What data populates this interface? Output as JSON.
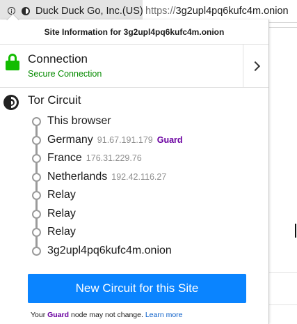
{
  "urlbar": {
    "org": "Duck Duck Go, Inc.(US)",
    "url_scheme": "https://",
    "url_host": "3g2upl4pq6kufc4m.onion"
  },
  "panel": {
    "header": "Site Information for 3g2upl4pq6kufc4m.onion",
    "connection": {
      "title": "Connection",
      "status": "Secure Connection"
    },
    "circuit": {
      "title": "Tor Circuit",
      "nodes": [
        {
          "name": "This browser",
          "ip": "",
          "badge": ""
        },
        {
          "name": "Germany",
          "ip": "91.67.191.179",
          "badge": "Guard"
        },
        {
          "name": "France",
          "ip": "176.31.229.76",
          "badge": ""
        },
        {
          "name": "Netherlands",
          "ip": "192.42.116.27",
          "badge": ""
        },
        {
          "name": "Relay",
          "ip": "",
          "badge": ""
        },
        {
          "name": "Relay",
          "ip": "",
          "badge": ""
        },
        {
          "name": "Relay",
          "ip": "",
          "badge": ""
        },
        {
          "name": "3g2upl4pq6kufc4m.onion",
          "ip": "",
          "badge": ""
        }
      ]
    },
    "new_circuit_label": "New Circuit for this Site",
    "guard_note": {
      "prefix": "Your",
      "guard": "Guard",
      "suffix": "node may not change.",
      "link": "Learn more"
    }
  },
  "colors": {
    "secure_green": "#12bc00",
    "secure_text": "#058b00",
    "button_blue": "#0a84ff",
    "guard_purple": "#6a00a0"
  }
}
